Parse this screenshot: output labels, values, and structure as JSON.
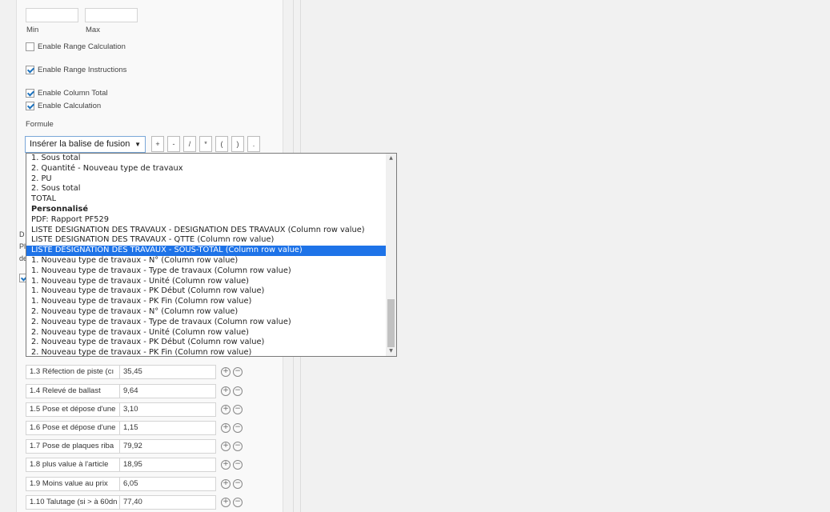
{
  "range": {
    "min_label": "Min",
    "max_label": "Max",
    "min_value": "",
    "max_value": ""
  },
  "checkboxes": [
    {
      "label": "Enable Range Calculation",
      "checked": false
    },
    {
      "label": "Enable Range Instructions",
      "checked": true
    },
    {
      "label": "Enable Column Total",
      "checked": true
    },
    {
      "label": "Enable Calculation",
      "checked": true
    }
  ],
  "formule": {
    "label": "Formule",
    "select_value": "Insérer la balise de fusion",
    "operators": [
      "+",
      "-",
      "/",
      "*",
      "(",
      ")",
      "."
    ]
  },
  "dropdown": {
    "options": [
      {
        "text": "1. Sous total",
        "type": "item"
      },
      {
        "text": "2. Quantité - Nouveau type de travaux",
        "type": "item"
      },
      {
        "text": "2. PU",
        "type": "item"
      },
      {
        "text": "2. Sous total",
        "type": "item"
      },
      {
        "text": "TOTAL",
        "type": "item"
      },
      {
        "text": "Personnalisé",
        "type": "group"
      },
      {
        "text": "PDF: Rapport PF529",
        "type": "item"
      },
      {
        "text": "LISTE DÉSIGNATION DES TRAVAUX - DÉSIGNATION DES TRAVAUX (Column row value)",
        "type": "item"
      },
      {
        "text": "LISTE DÉSIGNATION DES TRAVAUX - QTTE (Column row value)",
        "type": "item"
      },
      {
        "text": "LISTE DÉSIGNATION DES TRAVAUX - SOUS-TOTAL (Column row value)",
        "type": "selected"
      },
      {
        "text": "1. Nouveau type de travaux - N° (Column row value)",
        "type": "item"
      },
      {
        "text": "1. Nouveau type de travaux - Type de travaux (Column row value)",
        "type": "item"
      },
      {
        "text": "1. Nouveau type de travaux - Unité (Column row value)",
        "type": "item"
      },
      {
        "text": "1. Nouveau type de travaux - PK Début (Column row value)",
        "type": "item"
      },
      {
        "text": "1. Nouveau type de travaux - PK Fin (Column row value)",
        "type": "item"
      },
      {
        "text": "2. Nouveau type de travaux - N° (Column row value)",
        "type": "item"
      },
      {
        "text": "2. Nouveau type de travaux - Type de travaux (Column row value)",
        "type": "item"
      },
      {
        "text": "2. Nouveau type de travaux - Unité (Column row value)",
        "type": "item"
      },
      {
        "text": "2. Nouveau type de travaux - PK Début (Column row value)",
        "type": "item"
      },
      {
        "text": "2. Nouveau type de travaux - PK Fin (Column row value)",
        "type": "item"
      }
    ]
  },
  "hidden_fragments": [
    "D",
    "Pl",
    "de"
  ],
  "rows": [
    {
      "label": "1.3  Réfection de piste (cı",
      "value": "35,45"
    },
    {
      "label": "1.4  Relevé de ballast",
      "value": "9,64"
    },
    {
      "label": "1.5  Pose et dépose d'une",
      "value": "3,10"
    },
    {
      "label": "1.6  Pose et dépose d'une",
      "value": "1,15"
    },
    {
      "label": "1.7  Pose de plaques riba",
      "value": "79,92"
    },
    {
      "label": "1.8  plus value à l'article",
      "value": "18,95"
    },
    {
      "label": "1.9  Moins value au prix",
      "value": "6,05"
    },
    {
      "label": "1.10 Talutage (si > à 60dn",
      "value": "77,40"
    }
  ],
  "colors": {
    "accent": "#1e73e8",
    "checkmark": "#1e73be"
  }
}
